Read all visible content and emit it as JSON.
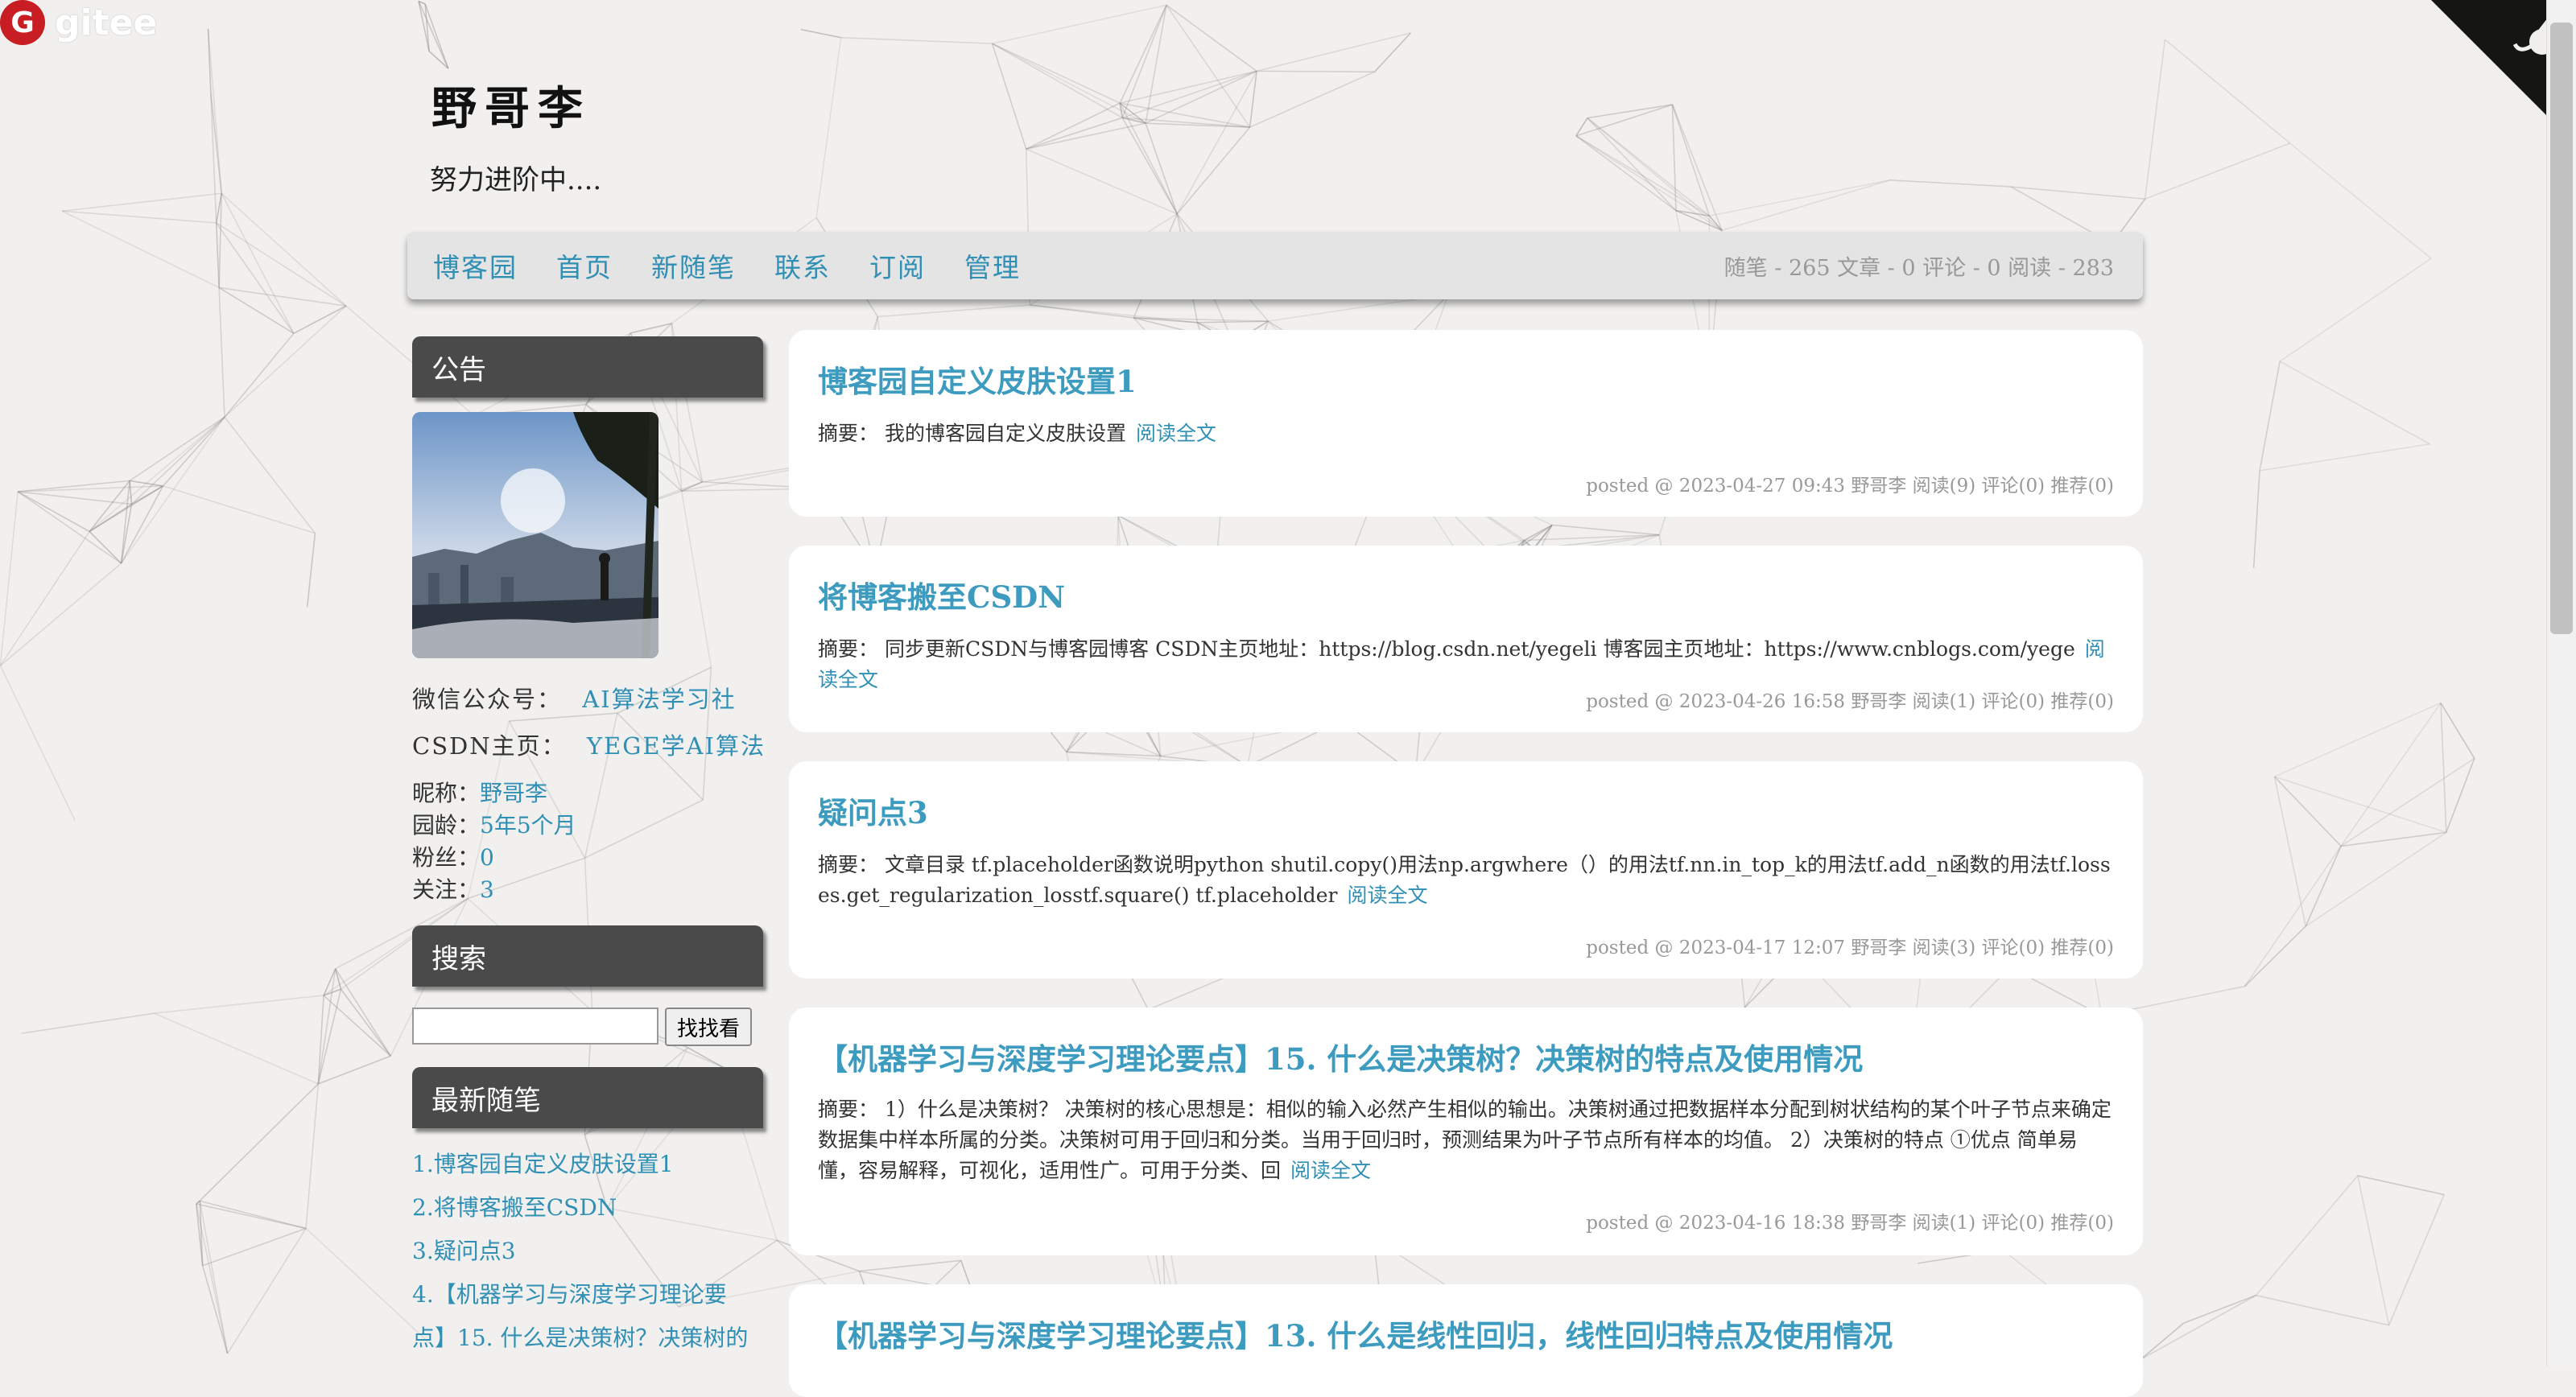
{
  "gitee": {
    "logo_letter": "G",
    "label": "gitee"
  },
  "blog": {
    "title": "野哥李",
    "subtitle": "努力进阶中...."
  },
  "nav": {
    "links": [
      "博客园",
      "首页",
      "新随笔",
      "联系",
      "订阅",
      "管理"
    ],
    "stats": "随笔 - 265  文章 - 0  评论 - 0  阅读 - 283"
  },
  "sidebar": {
    "notice_title": "公告",
    "wechat_label": "微信公众号：",
    "wechat_value": "AI算法学习社",
    "csdn_label": "CSDN主页：",
    "csdn_value": "YEGE学AI算法",
    "nickname_label": "昵称：",
    "nickname": "野哥李",
    "age_label": "园龄：",
    "age": "5年5个月",
    "fans_label": "粉丝：",
    "fans": "0",
    "follow_label": "关注：",
    "follow": "3",
    "search_title": "搜索",
    "search_button": "找找看",
    "search_value": "",
    "recent_title": "最新随笔",
    "recent": [
      "1.博客园自定义皮肤设置1",
      "2.将博客搬至CSDN",
      "3.疑问点3",
      "4.【机器学习与深度学习理论要点】15. 什么是决策树？决策树的"
    ]
  },
  "posts": [
    {
      "title": "博客园自定义皮肤设置1",
      "summary_label": "摘要：",
      "summary": "我的博客园自定义皮肤设置",
      "read_more": "阅读全文",
      "meta": "posted @ 2023-04-27 09:43 野哥李 阅读(9) 评论(0) 推荐(0)"
    },
    {
      "title": "将博客搬至CSDN",
      "summary_label": "摘要：",
      "summary": "同步更新CSDN与博客园博客 CSDN主页地址：https://blog.csdn.net/yegeli 博客园主页地址：https://www.cnblogs.com/yege",
      "read_more": "阅读全文",
      "meta": "posted @ 2023-04-26 16:58 野哥李 阅读(1) 评论(0) 推荐(0)"
    },
    {
      "title": "疑问点3",
      "summary_label": "摘要：",
      "summary": "文章目录 tf.placeholder函数说明python shutil.copy()用法np.argwhere（）的用法tf.nn.in_top_k的用法tf.add_n函数的用法tf.losses.get_regularization_losstf.square() tf.placeholder",
      "read_more": "阅读全文",
      "meta": "posted @ 2023-04-17 12:07 野哥李 阅读(3) 评论(0) 推荐(0)"
    },
    {
      "title": "【机器学习与深度学习理论要点】15. 什么是决策树？决策树的特点及使用情况",
      "summary_label": "摘要：",
      "summary": "1）什么是决策树？ 决策树的核心思想是：相似的输入必然产生相似的输出。决策树通过把数据样本分配到树状结构的某个叶子节点来确定数据集中样本所属的分类。决策树可用于回归和分类。当用于回归时，预测结果为叶子节点所有样本的均值。 2）决策树的特点 ①优点 简单易懂，容易解释，可视化，适用性广。可用于分类、回",
      "read_more": "阅读全文",
      "meta": "posted @ 2023-04-16 18:38 野哥李 阅读(1) 评论(0) 推荐(0)"
    },
    {
      "title": "【机器学习与深度学习理论要点】13. 什么是线性回归，线性回归特点及使用情况"
    }
  ]
}
